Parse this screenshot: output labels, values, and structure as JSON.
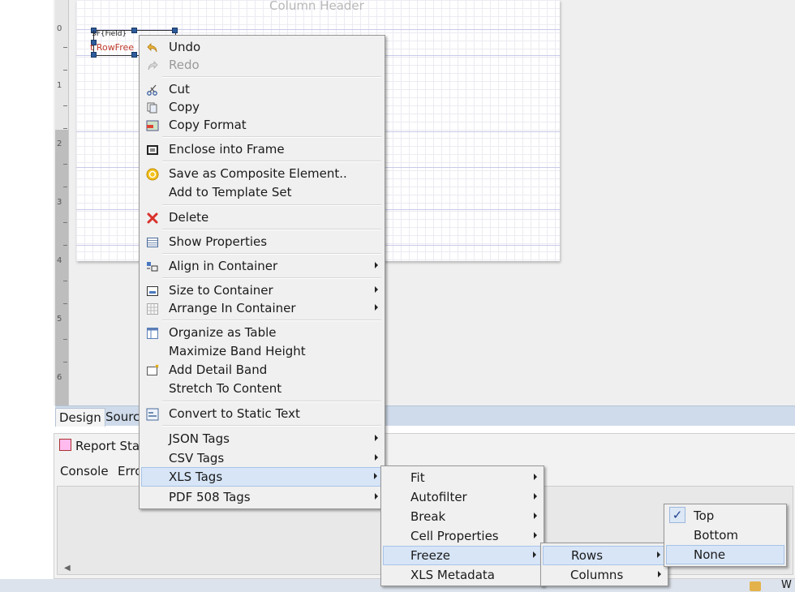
{
  "canvas": {
    "column_header": "Column Header",
    "field_text": "$F{Field}",
    "field_red": "t RowFree"
  },
  "ruler": {
    "marks": [
      "0",
      "1",
      "2",
      "3",
      "4",
      "5",
      "6"
    ]
  },
  "editor_tabs": {
    "design": "Design",
    "source": "Sourc"
  },
  "panel": {
    "title": "Report Sta",
    "tab_console": "Console",
    "tab_errors": "Erro"
  },
  "status_bar": {
    "text": "W"
  },
  "context_menu": {
    "undo": "Undo",
    "redo": "Redo",
    "cut": "Cut",
    "copy": "Copy",
    "copy_format": "Copy Format",
    "enclose_frame": "Enclose into Frame",
    "save_composite": "Save as Composite Element..",
    "add_template_set": "Add to Template Set",
    "delete": "Delete",
    "show_properties": "Show Properties",
    "align_container": "Align in Container",
    "size_container": "Size to Container",
    "arrange_container": "Arrange In Container",
    "organize_table": "Organize as Table",
    "maximize_band": "Maximize Band Height",
    "add_detail_band": "Add Detail Band",
    "stretch_content": "Stretch To Content",
    "convert_static": "Convert to Static Text",
    "json_tags": "JSON Tags",
    "csv_tags": "CSV Tags",
    "xls_tags": "XLS Tags",
    "pdf_tags": "PDF 508 Tags"
  },
  "xls_submenu": {
    "fit": "Fit",
    "autofilter": "Autofilter",
    "break": "Break",
    "cell_properties": "Cell Properties",
    "freeze": "Freeze",
    "xls_metadata": "XLS Metadata"
  },
  "freeze_submenu": {
    "rows": "Rows",
    "columns": "Columns"
  },
  "rows_submenu": {
    "top": "Top",
    "bottom": "Bottom",
    "none": "None",
    "checked": "top"
  },
  "colors": {
    "hover": "#d7e5f7",
    "menu_bg": "#f0f0f0",
    "tab_bar": "#cfdbea"
  }
}
